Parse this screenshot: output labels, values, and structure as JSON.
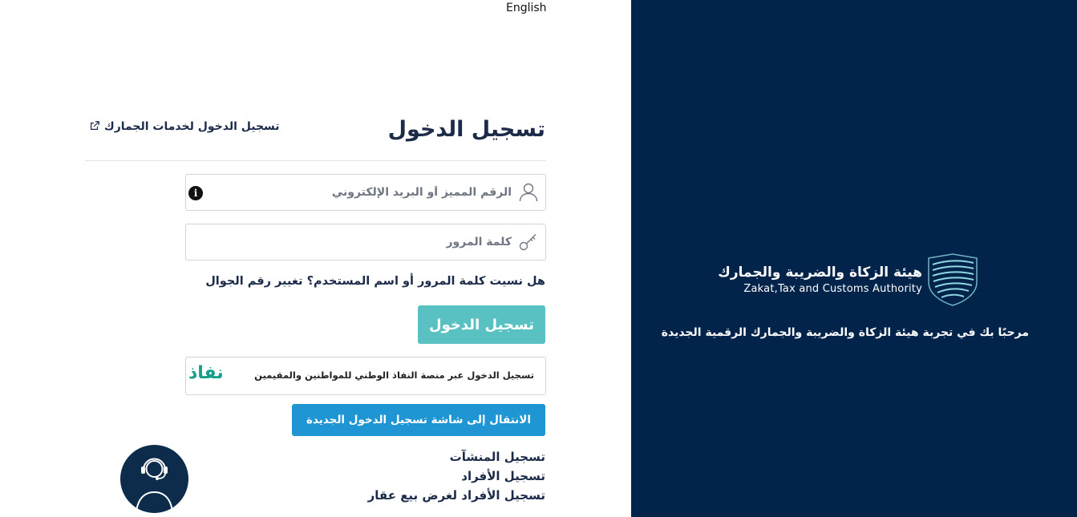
{
  "language_link": "English",
  "login": {
    "title": "تسجيل الدخول",
    "customs_link": "تسجيل الدخول لخدمات الجمارك",
    "username_placeholder": "الرقم المميز أو البريد الإلكتروني",
    "password_placeholder": "كلمة المرور",
    "info_glyph": "i",
    "forgot_text": "هل نسيت كلمة المرور أو اسم المستخدم؟",
    "change_mobile": "تغيير رقم الجوال",
    "submit_label": "تسجيل الدخول",
    "nafath_text": "تسجيل الدخول عبر منصة النفاذ الوطني للمواطنين والمقيمين",
    "nafath_logo": "نفاذ",
    "new_login_label": "الانتقال إلى شاشة تسجيل الدخول الجديدة"
  },
  "registration_links": [
    "تسجيل المنشآت",
    "تسجيل الأفراد",
    "تسجيل الأفراد لغرض بيع عقار"
  ],
  "brand": {
    "name_ar": "هيئة الزكاة والضريبة والجمارك",
    "name_en": "Zakat,Tax and Customs Authority",
    "welcome": "مرحبًا بك في تجربة هيئة الزكاة والضريبة والجمارك الرقمية الجديدة"
  },
  "icons": {
    "user": "user-icon",
    "key": "key-icon",
    "info": "info-icon",
    "external": "external-link-icon",
    "logo": "shield-logo-icon",
    "support": "support-agent-icon"
  },
  "colors": {
    "panel_bg": "#03244a",
    "login_button": "#59c1c1",
    "new_login_button": "#1f96d3",
    "nafath_green": "#12a08b",
    "support_bg": "#0d2b4a"
  }
}
